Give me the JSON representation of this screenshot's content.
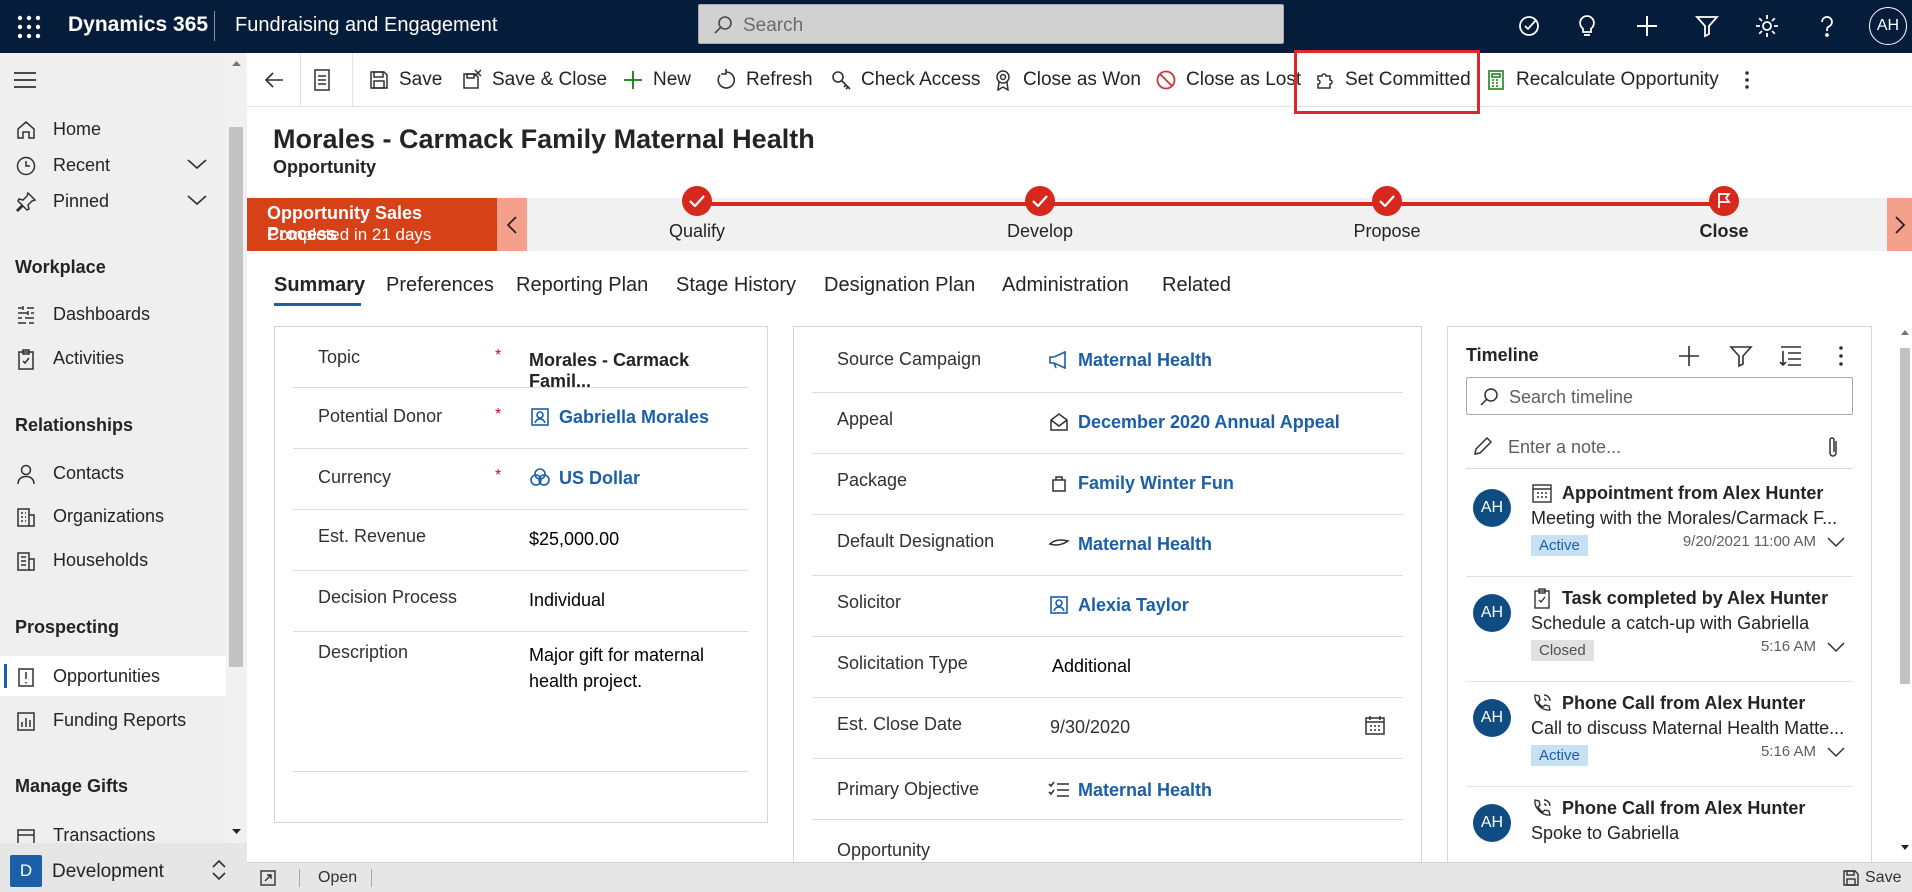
{
  "header": {
    "brand": "Dynamics 365",
    "app_name": "Fundraising and Engagement",
    "search_placeholder": "Search",
    "user_initials": "AH"
  },
  "sidebar": {
    "items": [
      {
        "label": "Home"
      },
      {
        "label": "Recent"
      },
      {
        "label": "Pinned"
      }
    ],
    "groups": {
      "workplace": {
        "title": "Workplace",
        "items": [
          "Dashboards",
          "Activities"
        ]
      },
      "relationships": {
        "title": "Relationships",
        "items": [
          "Contacts",
          "Organizations",
          "Households"
        ]
      },
      "prospecting": {
        "title": "Prospecting",
        "items": [
          "Opportunities",
          "Funding Reports"
        ]
      },
      "manage_gifts": {
        "title": "Manage Gifts",
        "items": [
          "Transactions"
        ]
      }
    },
    "area": {
      "badge": "D",
      "name": "Development"
    }
  },
  "commands": {
    "save": "Save",
    "save_close": "Save & Close",
    "new": "New",
    "refresh": "Refresh",
    "check_access": "Check Access",
    "close_won": "Close as Won",
    "close_lost": "Close as Lost",
    "set_committed": "Set Committed",
    "recalculate": "Recalculate Opportunity"
  },
  "record": {
    "title": "Morales - Carmack Family Maternal Health",
    "entity": "Opportunity"
  },
  "process": {
    "name": "Opportunity Sales Process",
    "status": "Completed in 21 days",
    "stages": [
      "Qualify",
      "Develop",
      "Propose",
      "Close"
    ]
  },
  "tabs": [
    "Summary",
    "Preferences",
    "Reporting Plan",
    "Stage History",
    "Designation Plan",
    "Administration",
    "Related"
  ],
  "summary": {
    "topic_label": "Topic",
    "topic_value": "Morales - Carmack Famil...",
    "donor_label": "Potential Donor",
    "donor_value": "Gabriella Morales",
    "currency_label": "Currency",
    "currency_value": "US Dollar",
    "revenue_label": "Est. Revenue",
    "revenue_value": "$25,000.00",
    "decision_label": "Decision Process",
    "decision_value": "Individual",
    "description_label": "Description",
    "description_line1": "Major gift for maternal",
    "description_line2": "health project."
  },
  "details": {
    "campaign_label": "Source Campaign",
    "campaign_value": "Maternal Health",
    "appeal_label": "Appeal",
    "appeal_value": "December 2020 Annual Appeal",
    "package_label": "Package",
    "package_value": "Family Winter Fun",
    "designation_label": "Default Designation",
    "designation_value": "Maternal Health",
    "solicitor_label": "Solicitor",
    "solicitor_value": "Alexia Taylor",
    "soltype_label": "Solicitation Type",
    "soltype_value": "Additional",
    "closedate_label": "Est. Close Date",
    "closedate_value": "9/30/2020",
    "objective_label": "Primary Objective",
    "objective_value": "Maternal Health",
    "opportunity_label": "Opportunity"
  },
  "timeline": {
    "title": "Timeline",
    "search_placeholder": "Search timeline",
    "note_placeholder": "Enter a note...",
    "items": [
      {
        "initials": "AH",
        "title": "Appointment from Alex Hunter",
        "subtitle": "Meeting with the Morales/Carmack F...",
        "status": "Active",
        "time": "9/20/2021 11:00 AM"
      },
      {
        "initials": "AH",
        "title": "Task completed by Alex Hunter",
        "subtitle": "Schedule a catch-up with Gabriella",
        "status": "Closed",
        "time": "5:16 AM"
      },
      {
        "initials": "AH",
        "title": "Phone Call from Alex Hunter",
        "subtitle": "Call to discuss Maternal Health Matte...",
        "status": "Active",
        "time": "5:16 AM"
      },
      {
        "initials": "AH",
        "title": "Phone Call from Alex Hunter",
        "subtitle": "Spoke to Gabriella"
      }
    ]
  },
  "statusbar": {
    "open": "Open",
    "save": "Save"
  },
  "colors": {
    "header_bg": "#061c3b",
    "accent": "#1b5fa8",
    "process_active": "#d64118",
    "process_line": "#d6281c",
    "highlight": "#e0252c"
  }
}
